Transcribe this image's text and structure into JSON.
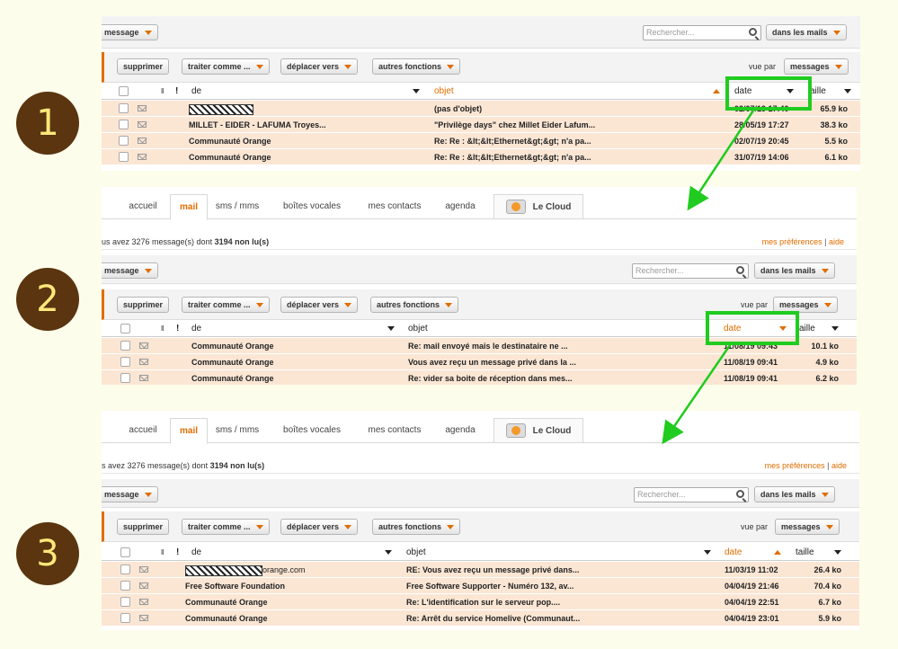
{
  "steps": [
    "1",
    "2",
    "3"
  ],
  "tabs": [
    "accueil",
    "mail",
    "sms / mms",
    "boîtes vocales",
    "mes contacts",
    "agenda",
    "Le Cloud"
  ],
  "info": {
    "prefix": "us avez 3276 message(s) dont",
    "unread": "3194 non lu(s)",
    "prefix3": "s avez 3276 message(s) dont",
    "preferences": "mes préférences",
    "separator": "|",
    "help": "aide"
  },
  "toolbar": {
    "new_message": "message",
    "search_placeholder": "Rechercher...",
    "search_scope": "dans les mails",
    "delete": "supprimer",
    "treat_as": "traiter comme ...",
    "move_to": "déplacer vers",
    "other": "autres fonctions",
    "view_by_label": "vue par",
    "view_by_value": "messages"
  },
  "columns": {
    "from": "de",
    "subject": "objet",
    "date": "date",
    "size": "taille",
    "size_cut": "aille",
    "flag": "!"
  },
  "panel1": {
    "rows": [
      {
        "from": "",
        "subject": "(pas d'objet)",
        "date": "02/07/19 17:40",
        "size": "65.9 ko",
        "redacted": true
      },
      {
        "from": "MILLET - EIDER - LAFUMA Troyes...",
        "subject": "\"Privilège days\" chez Millet Eider Lafum...",
        "date": "28/05/19 17:27",
        "size": "38.3 ko"
      },
      {
        "from": "Communauté Orange",
        "subject": "Re: Re : &lt;&lt;Ethernet&gt;&gt; n'a pa...",
        "date": "02/07/19 20:45",
        "size": "5.5 ko"
      },
      {
        "from": "Communauté Orange",
        "subject": "Re: Re : &lt;&lt;Ethernet&gt;&gt; n'a pa...",
        "date": "31/07/19 14:06",
        "size": "6.1 ko"
      }
    ]
  },
  "panel2": {
    "rows": [
      {
        "from": "Communauté Orange",
        "subject": "Re: mail envoyé mais le destinataire ne ...",
        "date": "11/08/19 09:43",
        "size": "10.1 ko"
      },
      {
        "from": "Communauté Orange",
        "subject": "Vous avez reçu un message privé dans la ...",
        "date": "11/08/19 09:41",
        "size": "4.9 ko"
      },
      {
        "from": "Communauté Orange",
        "subject": "Re: vider sa boite de réception dans mes...",
        "date": "11/08/19 09:41",
        "size": "6.2 ko"
      }
    ]
  },
  "panel3": {
    "rows": [
      {
        "from": "orange.com",
        "subject": "RE: Vous avez reçu un message privé dans...",
        "date": "11/03/19 11:02",
        "size": "26.4 ko",
        "redacted": true
      },
      {
        "from": "Free Software Foundation",
        "subject": "Free Software Supporter - Numéro 132, av...",
        "date": "04/04/19 21:46",
        "size": "70.4 ko"
      },
      {
        "from": "Communauté Orange",
        "subject": "Re: L'identification sur le serveur pop....",
        "date": "04/04/19 22:51",
        "size": "6.7 ko"
      },
      {
        "from": "Communauté Orange",
        "subject": "Re: Arrêt du service Homelive (Communaut...",
        "date": "04/04/19 23:01",
        "size": "5.9 ko"
      }
    ]
  },
  "colors": {
    "accent": "#e06d00",
    "highlight": "#1fcc1f",
    "row_bg": "#fbe6d4",
    "circle_bg": "#5a3510",
    "circle_text": "#ffe87a"
  }
}
